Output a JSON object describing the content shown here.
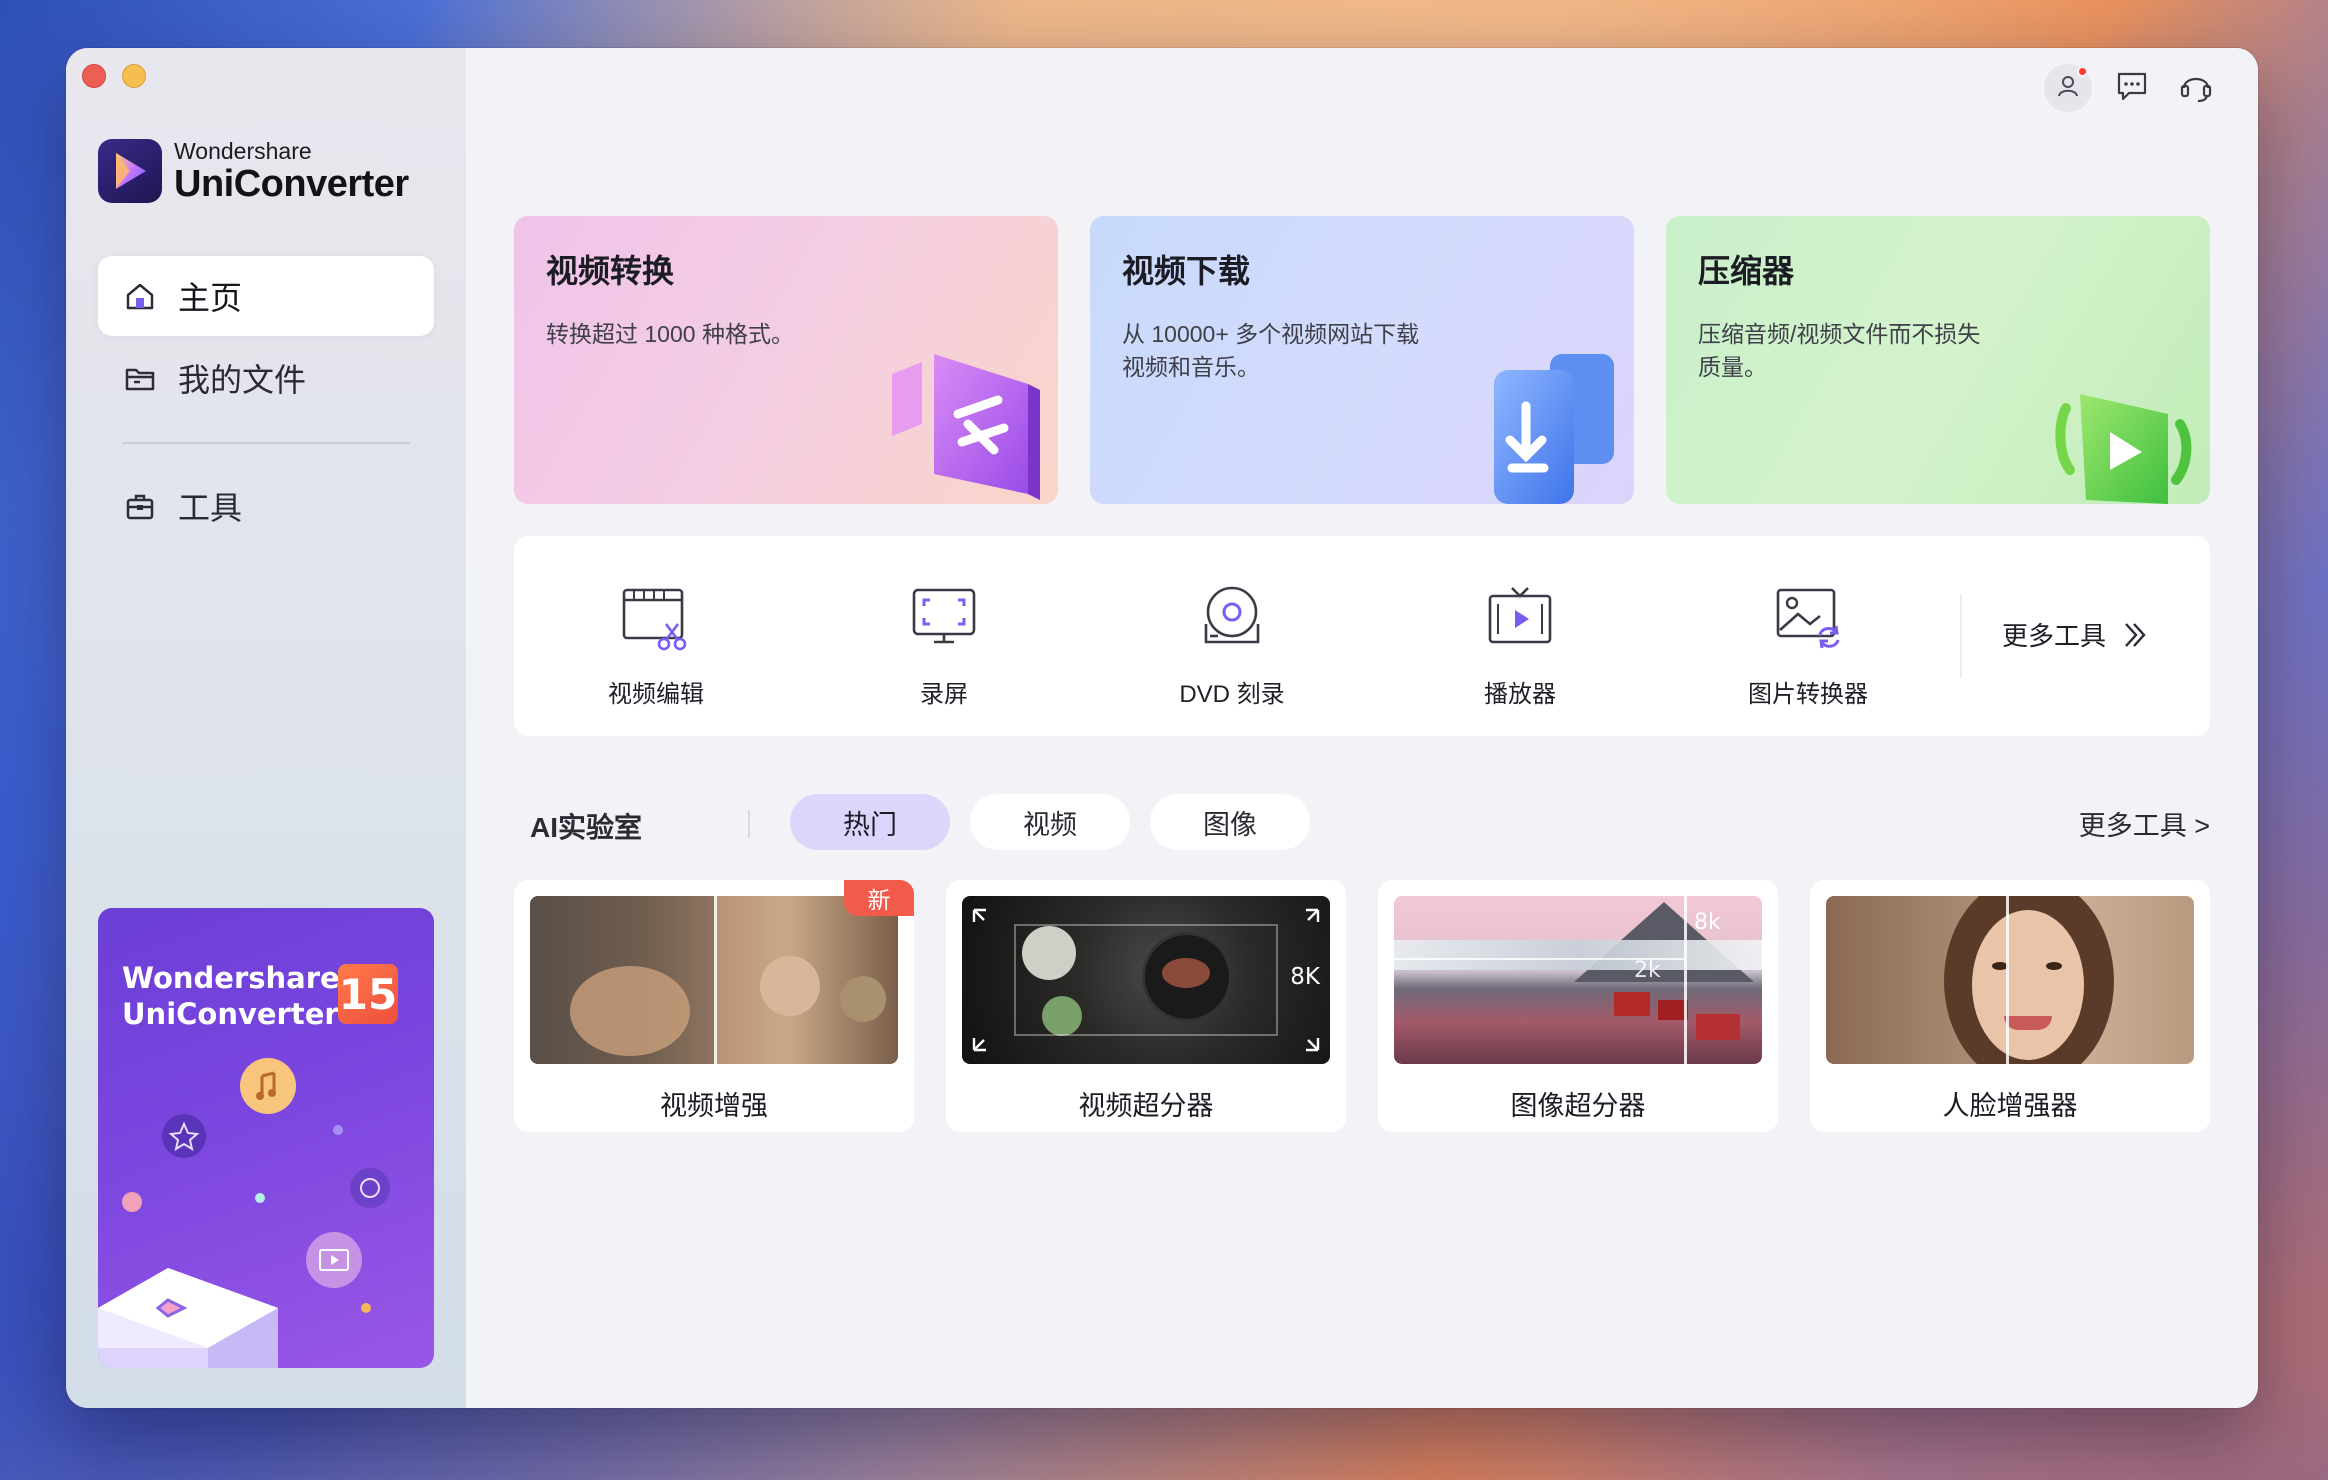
{
  "app": {
    "brand_small": "Wondershare",
    "brand_big": "UniConverter"
  },
  "sidebar": {
    "items": [
      {
        "label": "主页",
        "icon": "home-icon",
        "active": true
      },
      {
        "label": "我的文件",
        "icon": "folder-icon",
        "active": false
      },
      {
        "label": "工具",
        "icon": "toolbox-icon",
        "active": false
      }
    ],
    "promo": {
      "title_line1": "Wondershare",
      "title_line2": "UniConverter",
      "version": "15"
    }
  },
  "header": {
    "icons": [
      "user-icon",
      "chat-icon",
      "headset-icon"
    ],
    "notification_color": "#ff3b30"
  },
  "features": [
    {
      "title": "视频转换",
      "desc": "转换超过 1000 种格式。"
    },
    {
      "title": "视频下载",
      "desc": "从 10000+ 多个视频网站下载视频和音乐。"
    },
    {
      "title": "压缩器",
      "desc": "压缩音频/视频文件而不损失质量。"
    }
  ],
  "tools": [
    {
      "label": "视频编辑",
      "icon": "video-edit-icon"
    },
    {
      "label": "录屏",
      "icon": "screen-record-icon"
    },
    {
      "label": "DVD 刻录",
      "icon": "dvd-burn-icon"
    },
    {
      "label": "播放器",
      "icon": "player-icon"
    },
    {
      "label": "图片转换器",
      "icon": "image-convert-icon"
    }
  ],
  "more_tools_label": "更多工具",
  "ai_lab": {
    "label": "AI实验室",
    "tabs": [
      {
        "label": "热门",
        "active": true
      },
      {
        "label": "视频",
        "active": false
      },
      {
        "label": "图像",
        "active": false
      }
    ],
    "more_label": "更多工具 >",
    "cards": [
      {
        "label": "视频增强",
        "badge": "新"
      },
      {
        "label": "视频超分器",
        "overlay": "8K"
      },
      {
        "label": "图像超分器",
        "overlay_hi": "8k",
        "overlay_lo": "2k"
      },
      {
        "label": "人脸增强器"
      }
    ]
  },
  "colors": {
    "accent": "#7b46df",
    "tab_active_bg": "#dcd6fb",
    "badge_red": "#f25a4a"
  }
}
